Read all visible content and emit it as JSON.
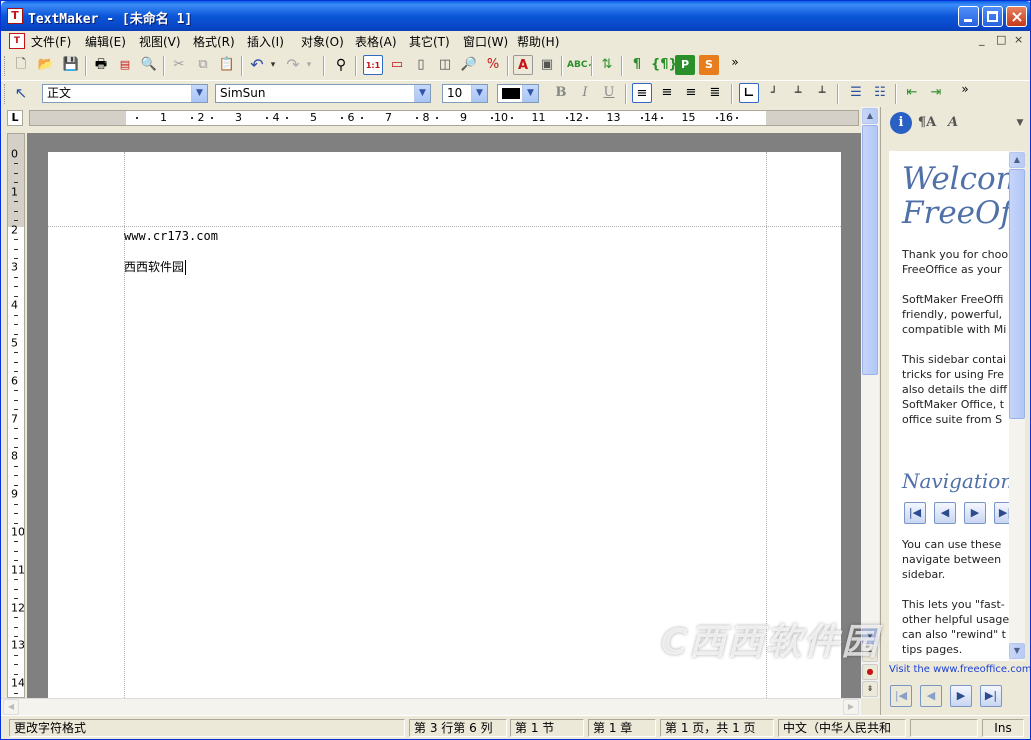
{
  "window": {
    "title": "TextMaker - [未命名 1]",
    "app_icon_letter": "T"
  },
  "menubar": {
    "items": [
      "文件(F)",
      "编辑(E)",
      "视图(V)",
      "格式(R)",
      "插入(I)",
      "对象(O)",
      "表格(A)",
      "其它(T)",
      "窗口(W)",
      "帮助(H)"
    ],
    "right_controls": [
      "_",
      "□",
      "×"
    ]
  },
  "toolbar2": {
    "style_value": "正文",
    "font_value": "SimSun",
    "size_value": "10",
    "bold": "B",
    "italic": "I",
    "underline": "U"
  },
  "ruler": {
    "corner": "L",
    "h_numbers": [
      "1",
      "2",
      "3",
      "4",
      "5",
      "6",
      "7",
      "8",
      "9",
      "10",
      "11",
      "12",
      "13",
      "14",
      "15",
      "16"
    ],
    "v_numbers": [
      "0",
      "1",
      "2",
      "3",
      "4",
      "5",
      "6",
      "7",
      "8",
      "9",
      "10",
      "11",
      "12",
      "13",
      "14"
    ]
  },
  "document": {
    "line1": "www.cr173.com",
    "line2": "西西软件园"
  },
  "sidebar": {
    "welcome_heading_1": "Welcom",
    "welcome_heading_2": "FreeOffi",
    "para1": "Thank you for choo\nFreeOffice as your",
    "para2": "SoftMaker FreeOffi\nfriendly, powerful,\ncompatible with Mi",
    "para3": "This sidebar contai\ntricks for using Fre\nalso details the diff\nSoftMaker Office, t\noffice suite from S",
    "navigation_heading": "Navigation",
    "para4": "You can use these\nnavigate between\nsidebar.",
    "para5": "This lets you \"fast-\nother helpful usage\ncan also \"rewind\" t\ntips pages.",
    "link": "Visit the www.freeoffice.com"
  },
  "statusbar": {
    "message": "更改字符格式",
    "position": "第 3 行第 6 列",
    "section": "第 1 节",
    "chapter": "第 1 章",
    "page": "第 1 页，共 1 页",
    "language": "中文（中华人民共和",
    "mode": "Ins"
  },
  "watermark": "西西软件园"
}
